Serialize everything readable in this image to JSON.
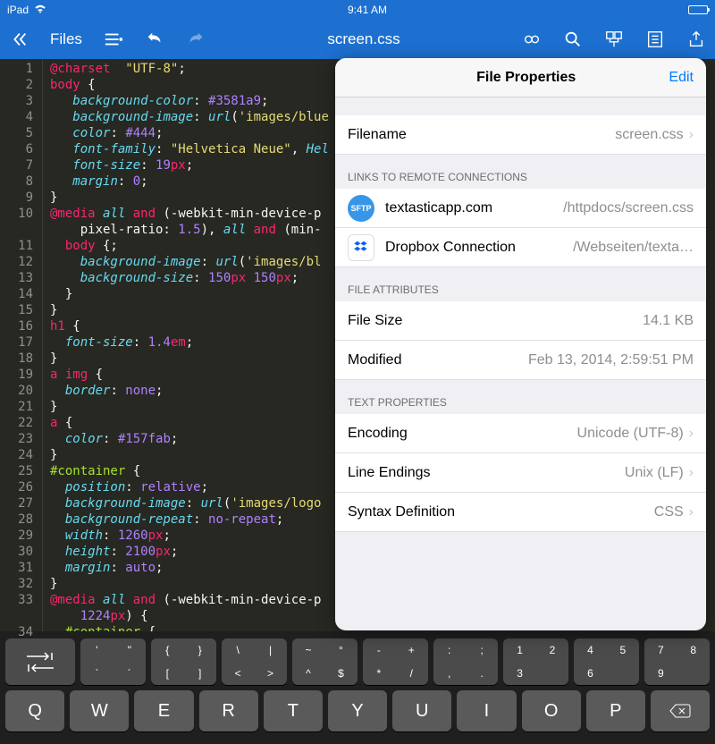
{
  "status": {
    "device": "iPad",
    "time": "9:41 AM"
  },
  "toolbar": {
    "files_label": "Files",
    "title": "screen.css"
  },
  "editor": {
    "lines": [
      "1",
      "2",
      "3",
      "4",
      "5",
      "6",
      "7",
      "8",
      "9",
      "10",
      "",
      "11",
      "12",
      "13",
      "14",
      "15",
      "16",
      "17",
      "18",
      "19",
      "20",
      "21",
      "22",
      "23",
      "24",
      "25",
      "26",
      "27",
      "28",
      "29",
      "30",
      "31",
      "32",
      "33",
      "",
      "34"
    ]
  },
  "popover": {
    "title": "File Properties",
    "edit": "Edit",
    "filename_label": "Filename",
    "filename_value": "screen.css",
    "links_header": "LINKS TO REMOTE CONNECTIONS",
    "conn1_name": "textasticapp.com",
    "conn1_path": "/httpdocs/screen.css",
    "conn2_name": "Dropbox Connection",
    "conn2_path": "/Webseiten/texta…",
    "attrs_header": "FILE ATTRIBUTES",
    "size_label": "File Size",
    "size_value": "14.1 KB",
    "modified_label": "Modified",
    "modified_value": "Feb 13, 2014, 2:59:51 PM",
    "text_header": "TEXT PROPERTIES",
    "encoding_label": "Encoding",
    "encoding_value": "Unicode (UTF-8)",
    "lineend_label": "Line Endings",
    "lineend_value": "Unix (LF)",
    "syntax_label": "Syntax Definition",
    "syntax_value": "CSS"
  },
  "keys": {
    "row": [
      [
        "'",
        "\"",
        "`",
        "´"
      ],
      [
        "{",
        "}",
        "[",
        "]"
      ],
      [
        "\\",
        "|",
        "<",
        ">"
      ],
      [
        "~",
        "°",
        "^",
        "$"
      ],
      [
        "-",
        "+",
        "*",
        "/"
      ],
      [
        ":",
        ";",
        ",",
        "."
      ],
      [
        "1",
        "2",
        "3",
        ""
      ],
      [
        "4",
        "5",
        "6",
        ""
      ],
      [
        "7",
        "8",
        "9",
        ""
      ]
    ],
    "letters": [
      "Q",
      "W",
      "E",
      "R",
      "T",
      "Y",
      "U",
      "I",
      "O",
      "P"
    ]
  }
}
